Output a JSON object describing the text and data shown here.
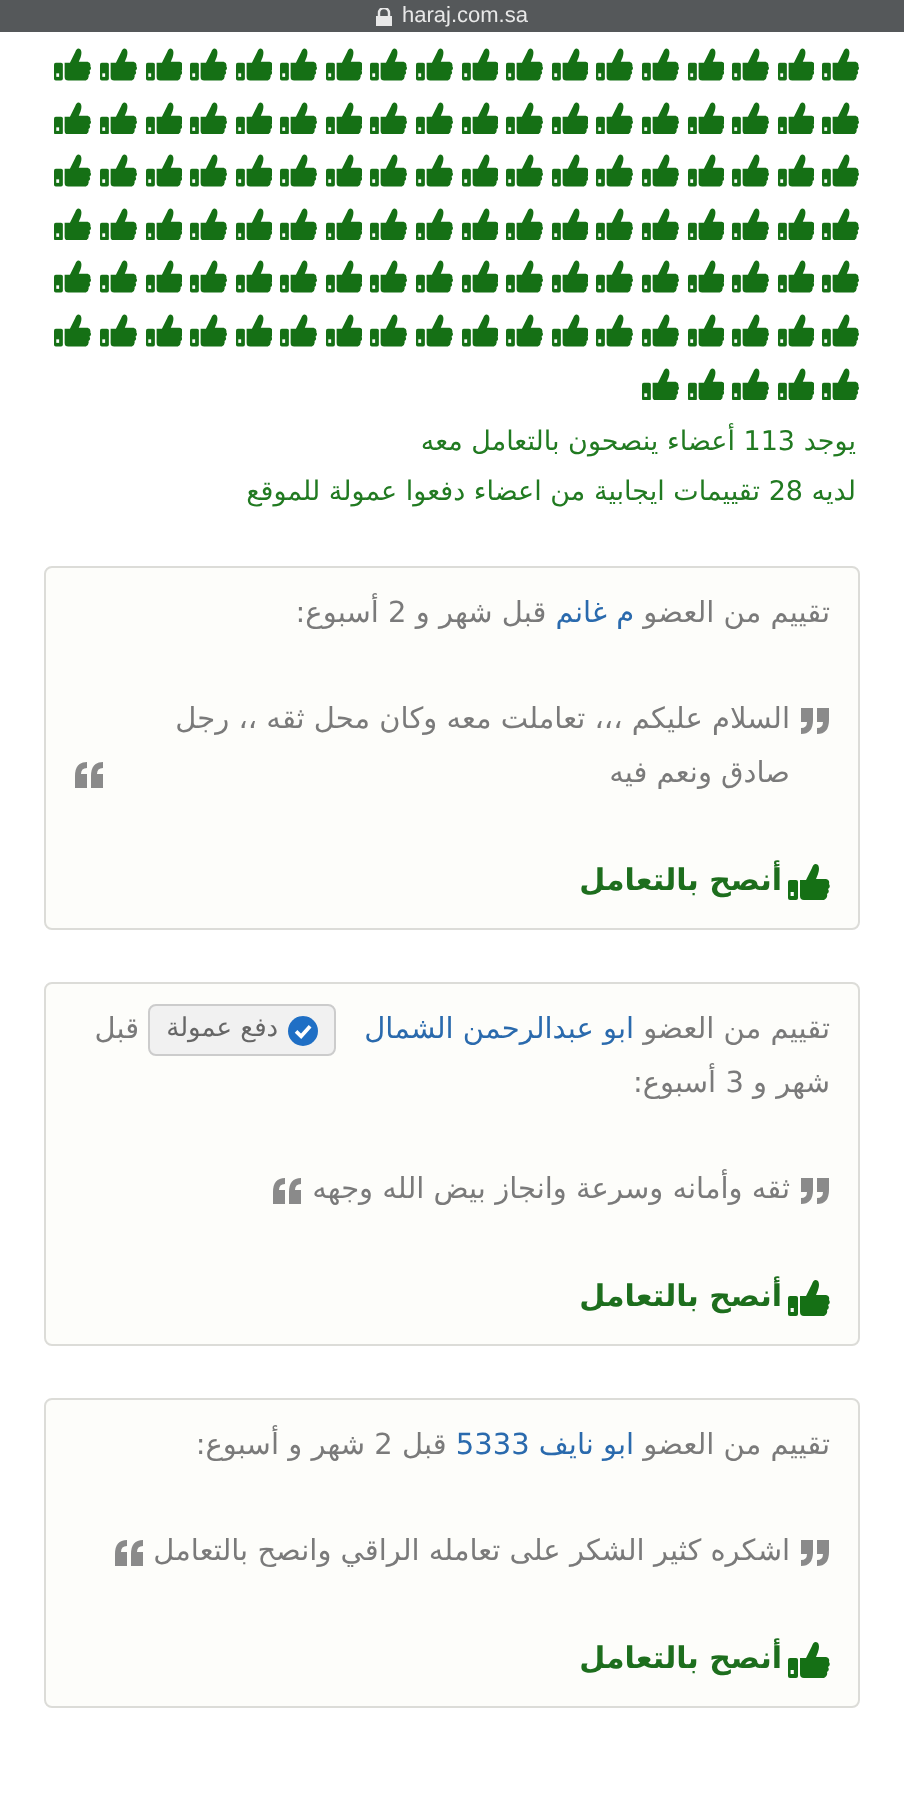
{
  "address_bar": {
    "url": "haraj.com.sa"
  },
  "thumbs": [
    {
      "kind": "thumb"
    },
    {
      "kind": "thumb"
    },
    {
      "kind": "thumb"
    },
    {
      "kind": "thumb"
    },
    {
      "kind": "thumb"
    },
    {
      "kind": "thumb"
    },
    {
      "kind": "thumb"
    },
    {
      "kind": "thumb"
    },
    {
      "kind": "thumb"
    },
    {
      "kind": "thumb"
    },
    {
      "kind": "thumb"
    },
    {
      "kind": "thumb"
    },
    {
      "kind": "thumb"
    },
    {
      "kind": "thumb"
    },
    {
      "kind": "thumb"
    },
    {
      "kind": "thumb"
    },
    {
      "kind": "thumb"
    },
    {
      "kind": "thumb"
    },
    {
      "kind": "thumb"
    },
    {
      "kind": "thumb"
    },
    {
      "kind": "thumb"
    },
    {
      "kind": "thumb"
    },
    {
      "kind": "thumb"
    },
    {
      "kind": "thumb"
    },
    {
      "kind": "thumb"
    },
    {
      "kind": "thumb"
    },
    {
      "kind": "thumb"
    },
    {
      "kind": "thumb"
    },
    {
      "kind": "thumb"
    },
    {
      "kind": "thumb"
    },
    {
      "kind": "thumb"
    },
    {
      "kind": "thumb"
    },
    {
      "kind": "thumb"
    },
    {
      "kind": "thumb"
    },
    {
      "kind": "thumb"
    },
    {
      "kind": "thumb"
    },
    {
      "kind": "thumb"
    },
    {
      "kind": "thumb"
    },
    {
      "kind": "thumb"
    },
    {
      "kind": "thumb"
    },
    {
      "kind": "thumb"
    },
    {
      "kind": "thumb"
    },
    {
      "kind": "thumb"
    },
    {
      "kind": "thumb"
    },
    {
      "kind": "thumb"
    },
    {
      "kind": "thumb"
    },
    {
      "kind": "thumb"
    },
    {
      "kind": "thumb"
    },
    {
      "kind": "thumb"
    },
    {
      "kind": "thumb"
    },
    {
      "kind": "thumb"
    },
    {
      "kind": "thumb"
    },
    {
      "kind": "thumb"
    },
    {
      "kind": "thumb"
    },
    {
      "kind": "thumb"
    },
    {
      "kind": "thumb"
    },
    {
      "kind": "thumb"
    },
    {
      "kind": "thumb"
    },
    {
      "kind": "thumb"
    },
    {
      "kind": "thumb"
    },
    {
      "kind": "thumb"
    },
    {
      "kind": "thumb"
    },
    {
      "kind": "thumb"
    },
    {
      "kind": "thumb"
    },
    {
      "kind": "thumb"
    },
    {
      "kind": "thumb"
    },
    {
      "kind": "thumb"
    },
    {
      "kind": "thumb"
    },
    {
      "kind": "thumb"
    },
    {
      "kind": "thumb"
    },
    {
      "kind": "thumb"
    },
    {
      "kind": "thumb"
    },
    {
      "kind": "thumb"
    },
    {
      "kind": "thumb"
    },
    {
      "kind": "thumb"
    },
    {
      "kind": "thumb"
    },
    {
      "kind": "thumb"
    },
    {
      "kind": "thumb"
    },
    {
      "kind": "thumb"
    },
    {
      "kind": "thumb"
    },
    {
      "kind": "thumb"
    },
    {
      "kind": "thumb"
    },
    {
      "kind": "thumb"
    },
    {
      "kind": "thumb"
    },
    {
      "kind": "thumb"
    },
    {
      "kind": "thumb"
    },
    {
      "kind": "thumb"
    },
    {
      "kind": "thumb"
    },
    {
      "kind": "thumb"
    },
    {
      "kind": "thumb"
    },
    {
      "kind": "thumb"
    },
    {
      "kind": "thumb"
    },
    {
      "kind": "thumb"
    },
    {
      "kind": "thumb"
    },
    {
      "kind": "thumb"
    },
    {
      "kind": "thumb"
    },
    {
      "kind": "thumb"
    },
    {
      "kind": "thumb"
    },
    {
      "kind": "thumb"
    },
    {
      "kind": "thumb"
    },
    {
      "kind": "thumb"
    },
    {
      "kind": "thumb"
    },
    {
      "kind": "thumb"
    },
    {
      "kind": "thumb"
    },
    {
      "kind": "thumb"
    },
    {
      "kind": "thumb"
    },
    {
      "kind": "thumb"
    },
    {
      "kind": "thumb"
    },
    {
      "kind": "thumb"
    },
    {
      "kind": "thumb"
    },
    {
      "kind": "thumb"
    },
    {
      "kind": "thumb"
    },
    {
      "kind": "thumb"
    }
  ],
  "summary": [
    "يوجد 113 أعضاء ينصحون بالتعامل معه",
    "لديه 28 تقييمات ايجابية من اعضاء دفعوا عمولة للموقع"
  ],
  "reviews": [
    {
      "prefix": "تقييم من العضو",
      "member": "م غانم",
      "time": "قبل شهر و 2 أسبوع:",
      "comment": "السلام عليكم ،،، تعاملت معه وكان محل ثقه ،، رجل صادق ونعم فيه",
      "recommend": "أنصح بالتعامل"
    },
    {
      "prefix": "تقييم من العضو",
      "member": "ابو عبدالرحمن الشمال",
      "badge": "دفع عمولة",
      "time": "قبل شهر و 3 أسبوع:",
      "comment": "ثقه وأمانه وسرعة وانجاز بيض الله وجهه",
      "recommend": "أنصح بالتعامل"
    },
    {
      "prefix": "تقييم من العضو",
      "member": "ابو نايف 5333",
      "time": "قبل 2 شهر و أسبوع:",
      "comment": "اشكره كثير الشكر على تعامله الراقي وانصح بالتعامل",
      "recommend": "أنصح بالتعامل"
    }
  ]
}
